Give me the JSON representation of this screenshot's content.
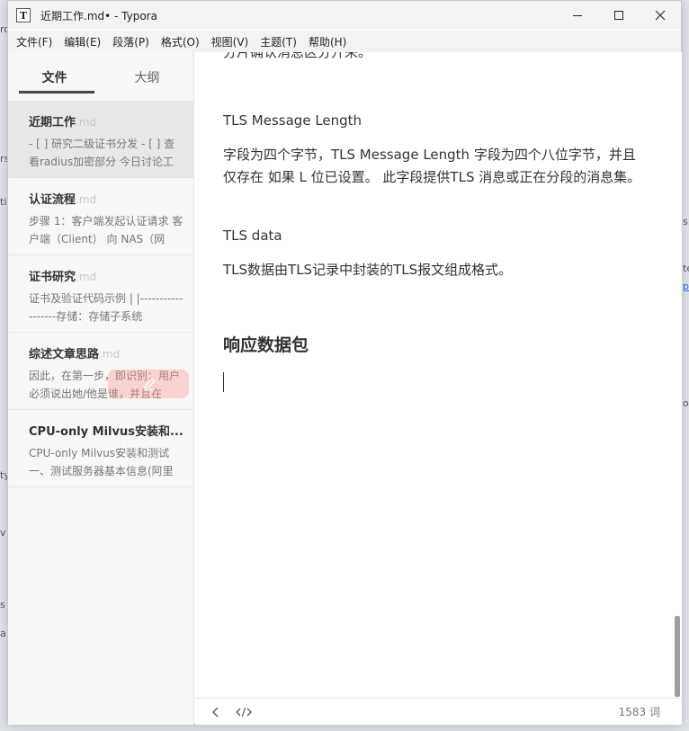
{
  "window": {
    "title": "近期工作.md• - Typora",
    "app_icon": "T"
  },
  "background_fragments": [
    "ro",
    "rs",
    "tic",
    "ty",
    "v",
    "s",
    "a",
    "s.",
    "te",
    "p",
    "ou"
  ],
  "menu": [
    {
      "label": "文件(F)"
    },
    {
      "label": "编辑(E)"
    },
    {
      "label": "段落(P)"
    },
    {
      "label": "格式(O)"
    },
    {
      "label": "视图(V)"
    },
    {
      "label": "主题(T)"
    },
    {
      "label": "帮助(H)"
    }
  ],
  "sidebar": {
    "tabs": [
      {
        "label": "文件"
      },
      {
        "label": "大纲"
      }
    ],
    "files": [
      {
        "name": "近期工作",
        "ext": ".md",
        "snippet": "- [ ] 研究二级证书分发 - [ ] 查看radius加密部分 今日讨论工"
      },
      {
        "name": "认证流程",
        "ext": ".md",
        "snippet": "步骤 1：客户端发起认证请求 客户端（Client） 向 NAS（网"
      },
      {
        "name": "证书研究",
        "ext": ".md",
        "snippet": "证书及验证代码示例 | |------------------存储：存储子系统"
      },
      {
        "name": "综述文章思路",
        "ext": ".md",
        "snippet": "因此，在第一步，即识别：用户必须说出她/他是谁，并且在"
      },
      {
        "name": "CPU-only Milvus安装和...",
        "ext": "",
        "snippet": "CPU-only Milvus安装和测试 一、测试服务器基本信息(阿里"
      }
    ]
  },
  "editor": {
    "cut_top_line": "分片确认消息区分开来。",
    "field1_title": "TLS Message Length",
    "field1_desc": "字段为四个字节，TLS Message Length 字段为四个八位字节，并且仅存在 如果 L 位已设置。 此字段提供TLS 消息或正在分段的消息集。",
    "field2_title": "TLS data",
    "field2_desc": "TLS数据由TLS记录中封装的TLS报文组成格式。",
    "heading": "响应数据包"
  },
  "status": {
    "word_count": "1583 词"
  }
}
